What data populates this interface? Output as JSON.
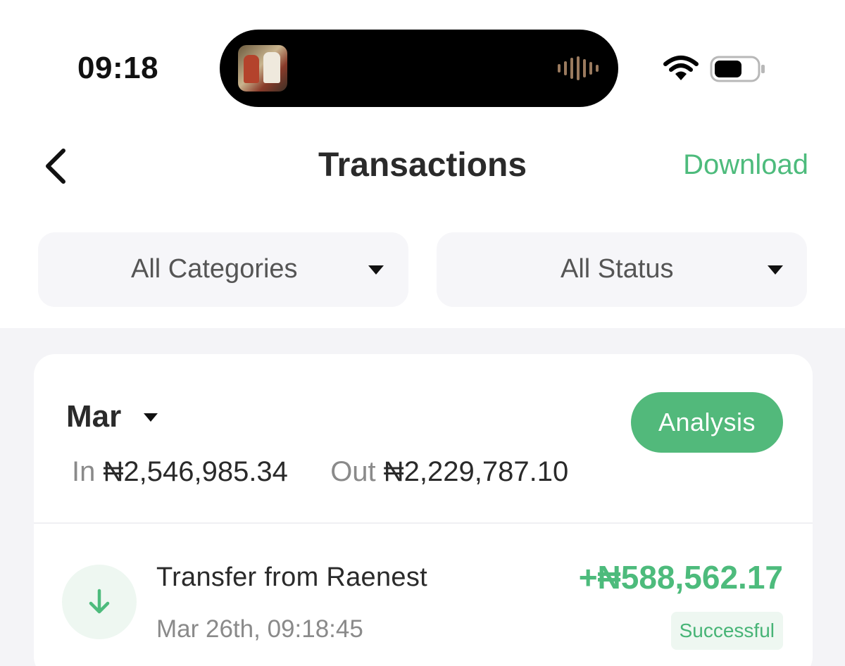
{
  "status_bar": {
    "time": "09:18"
  },
  "header": {
    "title": "Transactions",
    "download_label": "Download"
  },
  "filters": {
    "category_label": "All Categories",
    "status_label": "All Status"
  },
  "period": {
    "month": "Mar",
    "analysis_label": "Analysis",
    "in_label": "In",
    "in_amount": "₦2,546,985.34",
    "out_label": "Out",
    "out_amount": "₦2,229,787.10"
  },
  "transactions": [
    {
      "title": "Transfer from Raenest",
      "timestamp": "Mar 26th, 09:18:45",
      "amount": "+₦588,562.17",
      "status": "Successful",
      "direction_icon": "arrow-down-icon"
    }
  ],
  "colors": {
    "accent": "#4dbb7c",
    "button": "#52b97b",
    "filter_bg": "#f6f6f9",
    "content_bg": "#f4f4f7"
  }
}
